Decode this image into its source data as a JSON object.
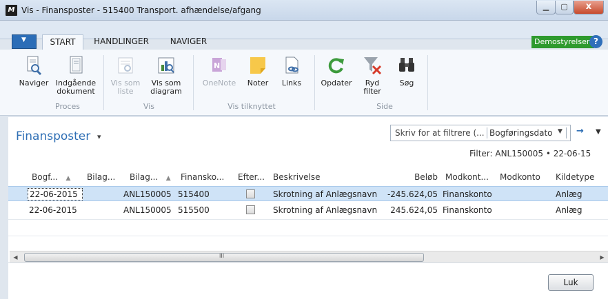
{
  "window": {
    "title": "Vis - Finansposter - 515400 Transport. afhændelse/afgang",
    "app_icon_text": "M",
    "min_glyph": "▁",
    "max_glyph": "▢",
    "close_glyph": "x"
  },
  "ribbon_tabs": {
    "menu_glyph": "▼",
    "start": "START",
    "handlinger": "HANDLINGER",
    "naviger": "NAVIGER"
  },
  "company": "Demostyrelsen",
  "help_glyph": "?",
  "ribbon": {
    "naviger": "Naviger",
    "indgaaende_line1": "Indgående",
    "indgaaende_line2": "dokument",
    "vis_som_liste_line1": "Vis som",
    "vis_som_liste_line2": "liste",
    "vis_som_diagram_line1": "Vis som",
    "vis_som_diagram_line2": "diagram",
    "onenote": "OneNote",
    "noter": "Noter",
    "links": "Links",
    "opdater": "Opdater",
    "ryd_filter_line1": "Ryd",
    "ryd_filter_line2": "filter",
    "soeg": "Søg",
    "groups": {
      "proces": "Proces",
      "vis": "Vis",
      "vis_tilknyttet": "Vis tilknyttet",
      "side": "Side"
    }
  },
  "page": {
    "title": "Finansposter",
    "title_caret": "▾"
  },
  "filter": {
    "placeholder": "Skriv for at filtrere (...",
    "field": "Bogføringsdato",
    "drop_glyph": "▼",
    "go_glyph": "→",
    "collapse_glyph": "▼",
    "summary": "Filter: ANL150005 • 22-06-15"
  },
  "columns": {
    "bogf": "Bogf...",
    "bilag1": "Bilag...",
    "bilag2": "Bilag...",
    "finansko": "Finansko...",
    "efter": "Efter...",
    "beskrivelse": "Beskrivelse",
    "beloeb": "Beløb",
    "modkont": "Modkont...",
    "modkonto": "Modkonto",
    "kildetype": "Kildetype",
    "sort_glyph": "▲"
  },
  "rows": [
    {
      "date": "22-06-2015",
      "bilagsnr": "ANL150005",
      "finanskonto": "515400",
      "beskrivelse": "Skrotning af Anlægsnavn",
      "beloeb": "-245.624,05",
      "modkontotype": "Finanskonto",
      "kildetype": "Anlæg"
    },
    {
      "date": "22-06-2015",
      "bilagsnr": "ANL150005",
      "finanskonto": "515500",
      "beskrivelse": "Skrotning af Anlægsnavn",
      "beloeb": "245.624,05",
      "modkontotype": "Finanskonto",
      "kildetype": "Anlæg"
    }
  ],
  "scrollbar": {
    "left_glyph": "◀",
    "right_glyph": "▶",
    "grip_glyph": "III"
  },
  "buttons": {
    "luk": "Luk"
  },
  "colors": {
    "accent_blue": "#2f6fb5",
    "company_green": "#2e9a2e",
    "selected_row": "#cfe3f7"
  }
}
